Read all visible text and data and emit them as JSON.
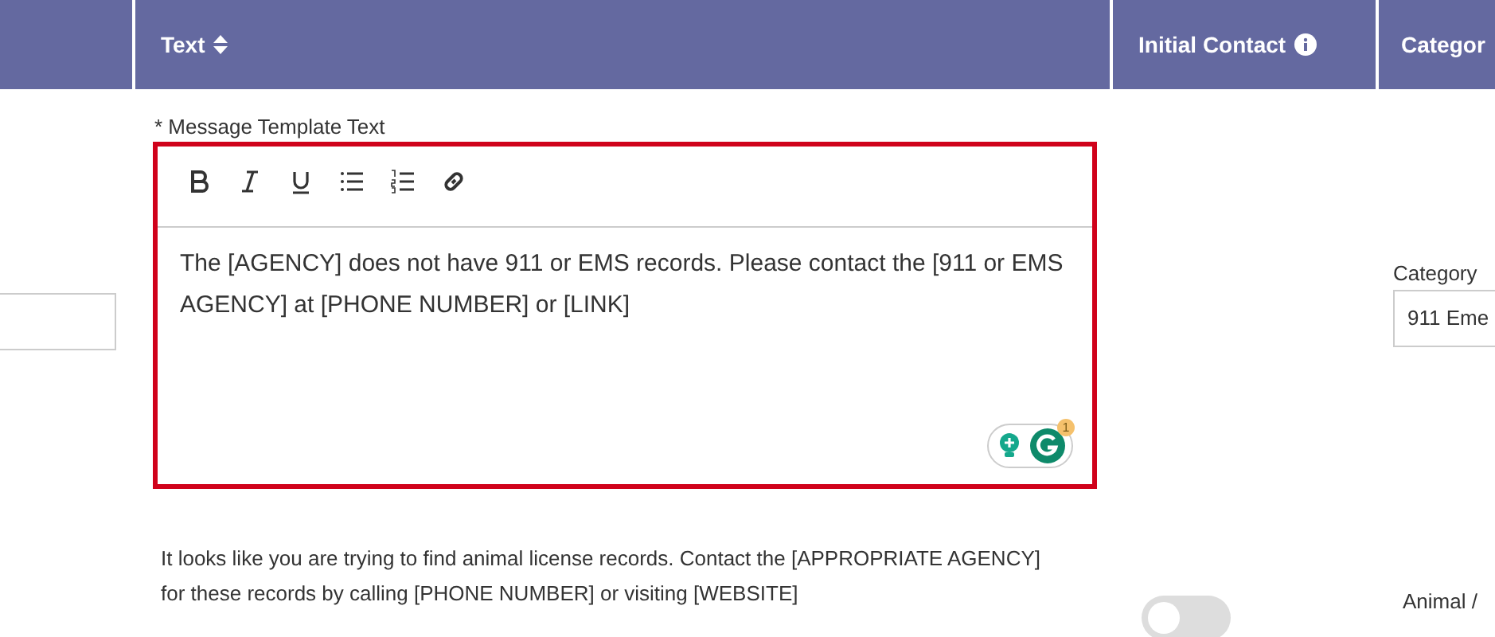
{
  "table": {
    "columns": [
      {},
      {
        "label": "Text",
        "sortable": true
      },
      {
        "label": "Initial Contact",
        "info": true
      },
      {
        "label": "Categor"
      }
    ],
    "rows": [
      {
        "editor": {
          "label": "* Message Template Text",
          "value": "The [AGENCY] does not have 911 or EMS records. Please contact the [911 or EMS AGENCY] at [PHONE NUMBER] or [LINK]",
          "invalid": true,
          "assistant_badge": "1"
        },
        "category_label": "Category",
        "category_value": "911 Eme"
      },
      {
        "text": "It looks like you are trying to find animal license records. Contact the [APPROPRIATE AGENCY] for these records by calling [PHONE NUMBER] or visiting [WEBSITE]",
        "initial_contact": {
          "on": false
        },
        "category_value": "Animal /"
      }
    ]
  }
}
